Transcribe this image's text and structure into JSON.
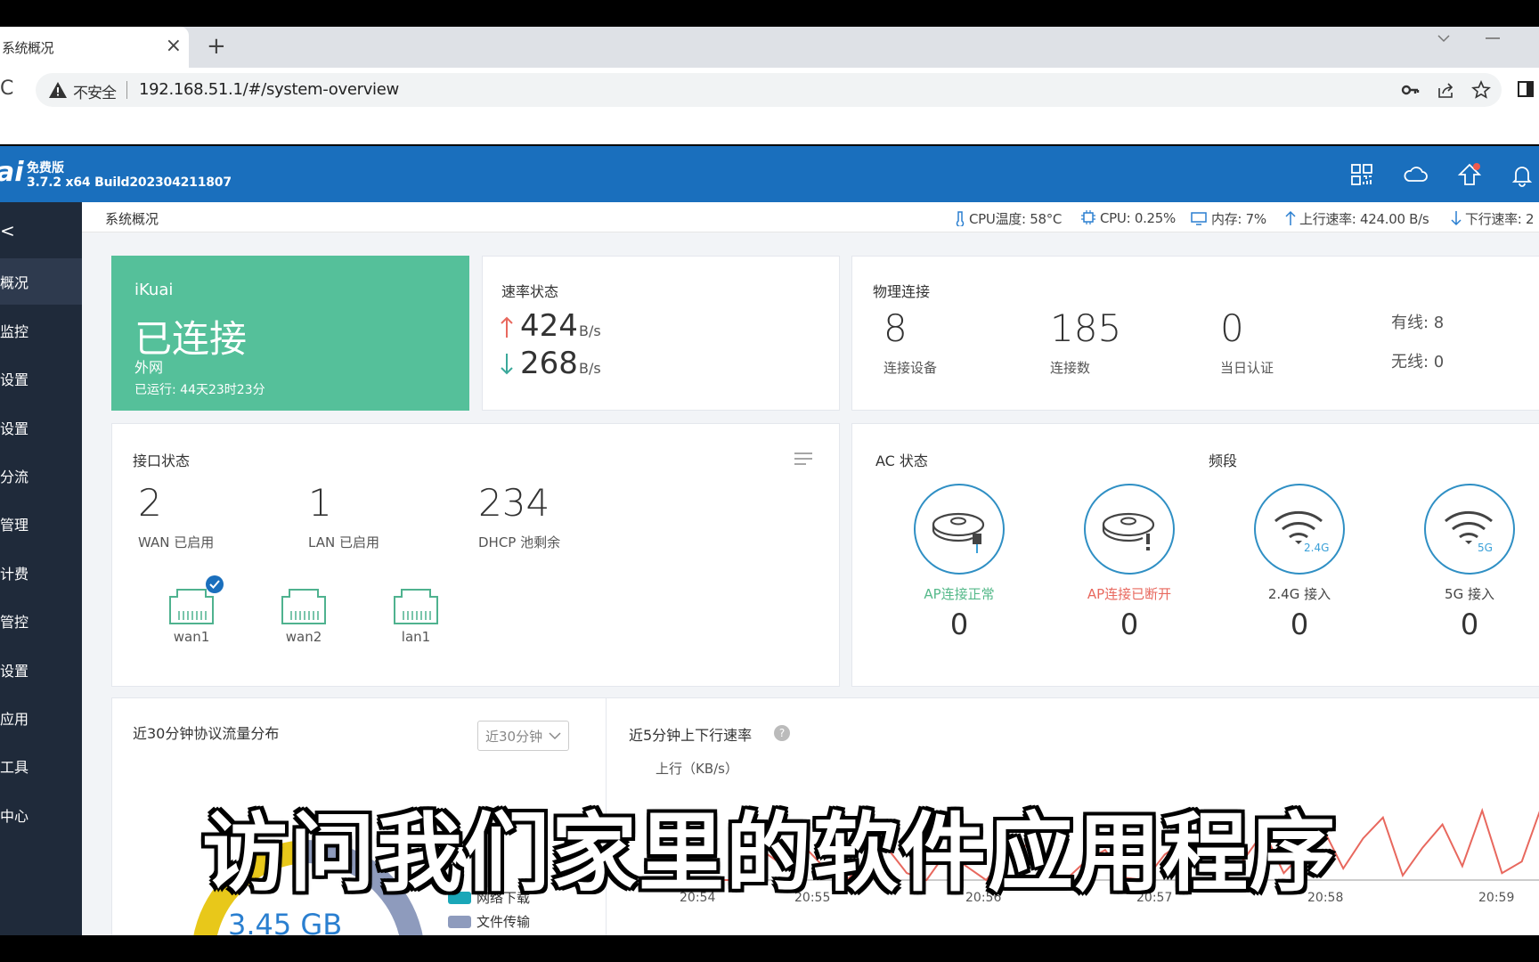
{
  "browser": {
    "tab_title": "系统概况",
    "tab_close": "×",
    "new_tab": "+",
    "security_label": "不安全",
    "url": "192.168.51.1/#/system-overview"
  },
  "app": {
    "logo": "ai",
    "edition": "免费版",
    "build": "3.7.2 x64 Build202304211807"
  },
  "sidebar": {
    "collapse": "<",
    "items": [
      {
        "label": "概况",
        "active": true
      },
      {
        "label": "监控"
      },
      {
        "label": "设置"
      },
      {
        "label": "设置"
      },
      {
        "label": "分流"
      },
      {
        "label": "管理"
      },
      {
        "label": "计费"
      },
      {
        "label": "管控"
      },
      {
        "label": "设置"
      },
      {
        "label": "应用"
      },
      {
        "label": "工具"
      },
      {
        "label": "中心"
      }
    ]
  },
  "topstrip": {
    "breadcrumb": "系统概况",
    "cpu_temp": "CPU温度: 58°C",
    "cpu": "CPU: 0.25%",
    "memory": "内存: 7%",
    "upload": "上行速率: 424.00 B/s",
    "download": "下行速率: 2"
  },
  "status_card": {
    "brand": "iKuai",
    "state": "已连接",
    "network": "外网",
    "uptime": "已运行: 44天23时23分"
  },
  "speed_card": {
    "title": "速率状态",
    "up_value": "424",
    "up_unit": "B/s",
    "down_value": "268",
    "down_unit": "B/s"
  },
  "physical_card": {
    "title": "物理连接",
    "devices_value": "8",
    "devices_label": "连接设备",
    "connections_value": "185",
    "connections_label": "连接数",
    "auth_value": "0",
    "auth_label": "当日认证",
    "wired": "有线: 8",
    "wireless": "无线: 0"
  },
  "interface_card": {
    "title": "接口状态",
    "wan_value": "2",
    "wan_label": "WAN 已启用",
    "lan_value": "1",
    "lan_label": "LAN 已启用",
    "dhcp_value": "234",
    "dhcp_label": "DHCP 池剩余",
    "ports": [
      "wan1",
      "wan2",
      "lan1"
    ]
  },
  "ac_card": {
    "title": "AC 状态",
    "band_title": "频段",
    "items": [
      {
        "label": "AP连接正常",
        "value": "0",
        "color": "#55b98a"
      },
      {
        "label": "AP连接已断开",
        "value": "0",
        "color": "#e8685e"
      },
      {
        "label": "2.4G 接入",
        "value": "0",
        "color": "#444444"
      },
      {
        "label": "5G 接入",
        "value": "0",
        "color": "#444444"
      }
    ]
  },
  "protocol_card": {
    "title": "近30分钟协议流量分布",
    "range": "近30分钟",
    "total": "3.45 GB",
    "legend": [
      {
        "label": "网络下载",
        "color": "#1aa7b8"
      },
      {
        "label": "文件传输",
        "color": "#8e9bbd"
      }
    ]
  },
  "rate_card": {
    "title": "近5分钟上下行速率",
    "help": "?",
    "y_label": "上行（KB/s）",
    "y_zero": "0",
    "chart_data": {
      "type": "line",
      "x_ticks": [
        "20:54",
        "20:55",
        "20:56",
        "20:57",
        "20:58",
        "20:59"
      ],
      "series": [
        {
          "values": [
            0,
            0,
            0,
            2,
            11,
            5,
            13,
            4,
            0,
            9,
            14,
            3,
            0,
            12,
            6,
            0,
            10,
            15,
            2,
            0,
            8,
            13,
            1,
            0,
            11,
            17,
            4,
            0,
            9,
            21,
            3,
            12,
            22,
            5,
            18,
            27,
            2,
            14,
            24,
            6,
            30,
            3,
            8,
            32
          ]
        }
      ]
    }
  },
  "overlay": {
    "subtitle": "访问我们家里的软件应用程序"
  },
  "colors": {
    "header_blue": "#1a6fbd",
    "sidebar": "#1f2a3a",
    "status_green": "#55c09a",
    "up_arrow": "#e8685e",
    "down_arrow": "#3aa89a",
    "rate_line": "#e8685e"
  }
}
